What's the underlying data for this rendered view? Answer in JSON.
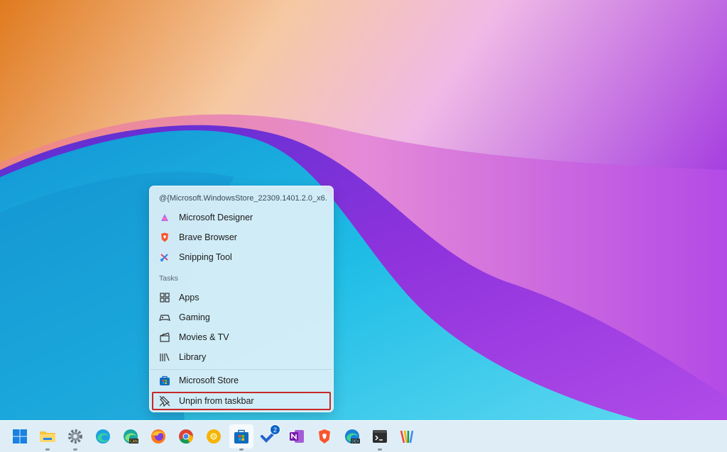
{
  "jumplist": {
    "header": "@{Microsoft.WindowsStore_22309.1401.2.0_x6...",
    "pinned": [
      {
        "label": "Microsoft Designer",
        "icon": "designer-icon"
      },
      {
        "label": "Brave Browser",
        "icon": "brave-icon"
      },
      {
        "label": "Snipping Tool",
        "icon": "snipping-tool-icon"
      }
    ],
    "tasks_heading": "Tasks",
    "tasks": [
      {
        "label": "Apps",
        "icon": "apps-grid-icon"
      },
      {
        "label": "Gaming",
        "icon": "gamepad-icon"
      },
      {
        "label": "Movies & TV",
        "icon": "clapperboard-icon"
      },
      {
        "label": "Library",
        "icon": "library-icon"
      }
    ],
    "app_item": {
      "label": "Microsoft Store",
      "icon": "microsoft-store-icon"
    },
    "unpin_item": {
      "label": "Unpin from taskbar",
      "icon": "unpin-icon"
    }
  },
  "taskbar": {
    "icons": [
      {
        "name": "start-button",
        "icon": "windows-logo-icon"
      },
      {
        "name": "file-explorer",
        "icon": "folder-icon"
      },
      {
        "name": "settings",
        "icon": "gear-icon"
      },
      {
        "name": "edge",
        "icon": "edge-icon"
      },
      {
        "name": "edge-canary",
        "icon": "edge-canary-icon",
        "label": "CAN"
      },
      {
        "name": "firefox",
        "icon": "firefox-icon"
      },
      {
        "name": "chrome",
        "icon": "chrome-icon"
      },
      {
        "name": "chrome-canary",
        "icon": "chrome-canary-icon"
      },
      {
        "name": "microsoft-store",
        "icon": "store-icon"
      },
      {
        "name": "todo",
        "icon": "todo-icon",
        "badge": "2"
      },
      {
        "name": "onenote",
        "icon": "onenote-icon"
      },
      {
        "name": "brave",
        "icon": "brave-icon"
      },
      {
        "name": "edge-dev",
        "icon": "edge-dev-icon",
        "label": "DEV"
      },
      {
        "name": "terminal",
        "icon": "terminal-icon"
      },
      {
        "name": "app",
        "icon": "colorful-app-icon"
      }
    ]
  },
  "colors": {
    "accent_highlight": "#c62828",
    "store_blue": "#0f6cbd",
    "wallpaper_orange": "#e9892e",
    "wallpaper_purple": "#8f2bd6",
    "wallpaper_cyan": "#19b8e3"
  }
}
